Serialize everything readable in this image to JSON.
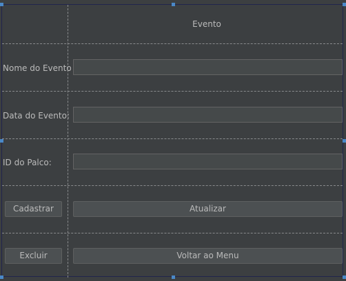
{
  "form": {
    "title": "Evento",
    "fields": [
      {
        "label": "Nome do Evento",
        "value": ""
      },
      {
        "label": "Data do Evento:",
        "value": ""
      },
      {
        "label": "ID do Palco:",
        "value": ""
      }
    ],
    "buttons": {
      "cadastrar": "Cadastrar",
      "atualizar": "Atualizar",
      "excluir": "Excluir",
      "voltar": "Voltar ao Menu"
    }
  },
  "colors": {
    "background": "#3c3f41",
    "field_bg": "#45494a",
    "button_bg": "#4c5052",
    "selection_handle": "#4a88c7"
  }
}
